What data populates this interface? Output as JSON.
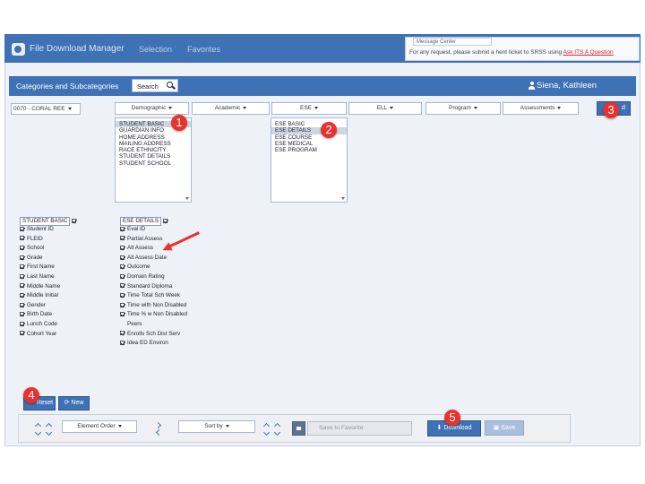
{
  "app": {
    "title": "File Download Manager",
    "nav": [
      "Selection",
      "Favorites"
    ]
  },
  "message_center": {
    "title": "Message Center",
    "text": "For any request, please submit a hent ticket to SRSS using ",
    "link": "Ask ITS A Question"
  },
  "header": {
    "title": "Categories and Subcategories",
    "search_label": "Search",
    "user_name": "Siena, Kathleen"
  },
  "filters": {
    "school": "0070 - CORAL REE",
    "tabs": [
      "Demographic",
      "Academic",
      "ESE",
      "ELL",
      "Program",
      "Assessments"
    ],
    "top_right_button": "d"
  },
  "lists": {
    "demographic": [
      "STUDENT BASIC",
      "GUARDIAN INFO",
      "HOME ADDRESS",
      "MAILING ADDRESS",
      "RACE ETHNICITY",
      "STUDENT DETAILS",
      "STUDENT SCHOOL"
    ],
    "ese": [
      "ESE BASIC",
      "ESE DETAILS",
      "ESE COURSE",
      "ESE MEDICAL",
      "ESE PROGRAM"
    ]
  },
  "student_basic": {
    "header": "STUDENT BASIC",
    "fields": [
      "Student ID",
      "FLEID",
      "School",
      "Grade",
      "First Name",
      "Last Name",
      "Middle Name",
      "Middle Initial",
      "Gender",
      "Birth Date",
      "Lunch Code",
      "Cohort Year"
    ]
  },
  "ese_details": {
    "header": "ESE DETAILS",
    "fields": [
      "Eval ID",
      "Partial Assess",
      "Alt Assess",
      "Alt Assess Date",
      "Outcome",
      "Domain Rating",
      "Standard Diploma",
      "Time Total Sch Week",
      "Time with Non Disabled",
      "Time % w Non Disabled",
      "Peers",
      "Enrolls Sch Dist Serv",
      "Idea ED Environ"
    ]
  },
  "actions": {
    "reset": "Reset",
    "new": "New",
    "element_order": "Element Order",
    "sort_by": "Sort by",
    "save_to_favorite": "Save to Favorite",
    "download": "Download",
    "save": "Save"
  },
  "badges": [
    "1",
    "2",
    "3",
    "4",
    "5"
  ],
  "colors": {
    "primary": "#3f71b5",
    "badge": "#e8322d",
    "link": "#d8262a"
  }
}
